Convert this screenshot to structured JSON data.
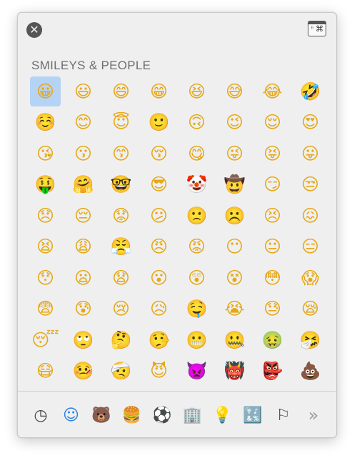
{
  "header": {
    "close_glyph": "✕",
    "viewer_dots": "⠿",
    "viewer_cmd": "⌘"
  },
  "section": {
    "title": "SMILEYS & PEOPLE"
  },
  "selected_index": 0,
  "emoji_color": "#e6a817",
  "selection_color": "#b5d3f5",
  "emojis": [
    "😀",
    "😃",
    "😄",
    "😁",
    "😆",
    "😅",
    "😂",
    "🤣",
    "☺️",
    "😊",
    "😇",
    "🙂",
    "🙃",
    "😉",
    "😌",
    "😍",
    "😘",
    "😗",
    "😙",
    "😚",
    "😋",
    "😜",
    "😝",
    "😛",
    "🤑",
    "🤗",
    "🤓",
    "😎",
    "🤡",
    "🤠",
    "😏",
    "😒",
    "😞",
    "😔",
    "😟",
    "😕",
    "🙁",
    "☹️",
    "😣",
    "😖",
    "😫",
    "😩",
    "😤",
    "😠",
    "😡",
    "😶",
    "😐",
    "😑",
    "😯",
    "😦",
    "😧",
    "😮",
    "😲",
    "😵",
    "😳",
    "😱",
    "😨",
    "😰",
    "😢",
    "😥",
    "🤤",
    "😭",
    "😓",
    "😪",
    "😴",
    "🙄",
    "🤔",
    "🤥",
    "😬",
    "🤐",
    "🤢",
    "🤧",
    "😷",
    "🤒",
    "🤕",
    "😈",
    "👿",
    "👹",
    "👺",
    "💩",
    "👻",
    "💀",
    "☠️",
    "👽",
    "👾",
    "🤖",
    "🎃",
    "😺"
  ],
  "categories": [
    {
      "name": "frequently-used",
      "glyph": "◷",
      "active": false
    },
    {
      "name": "smileys-people",
      "glyph": "☺",
      "active": true
    },
    {
      "name": "animals-nature",
      "glyph": "🐻",
      "active": false
    },
    {
      "name": "food-drink",
      "glyph": "🍔",
      "active": false
    },
    {
      "name": "activity",
      "glyph": "⚽",
      "active": false
    },
    {
      "name": "travel-places",
      "glyph": "🏢",
      "active": false
    },
    {
      "name": "objects",
      "glyph": "💡",
      "active": false
    },
    {
      "name": "symbols",
      "glyph": "🔣",
      "active": false
    },
    {
      "name": "flags",
      "glyph": "⚐",
      "active": false
    },
    {
      "name": "more",
      "glyph": "»",
      "active": false
    }
  ]
}
